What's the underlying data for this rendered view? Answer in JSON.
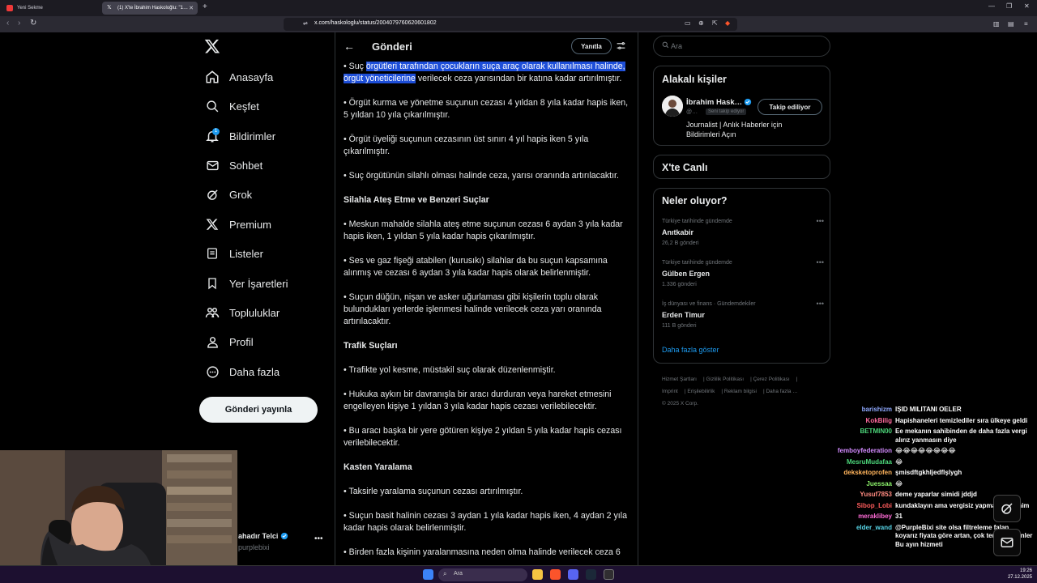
{
  "browser": {
    "tabs": [
      {
        "label": "Yeni Sekme"
      },
      {
        "label": "(1) X'te İbrahim Haskoloğlu: \"1…"
      }
    ],
    "url": "x.com/haskologlu/status/2004079760620601802"
  },
  "x": {
    "nav": [
      {
        "label": "Anasayfa"
      },
      {
        "label": "Keşfet"
      },
      {
        "label": "Bildirimler",
        "badge": "1"
      },
      {
        "label": "Sohbet"
      },
      {
        "label": "Grok"
      },
      {
        "label": "Premium"
      },
      {
        "label": "Listeler"
      },
      {
        "label": "Yer İşaretleri"
      },
      {
        "label": "Topluluklar"
      },
      {
        "label": "Profil"
      },
      {
        "label": "Daha fazla"
      }
    ],
    "post_button": "Gönderi yayınla",
    "account": {
      "name": "ahadır Telci",
      "handle": "purplebixi"
    }
  },
  "main": {
    "title": "Gönderi",
    "reply_button": "Yanıtla",
    "body": {
      "p1_a": "• Suç ",
      "p1_hl": "örgütleri tarafından çocukların suça araç olarak kullanılması halinde, örgüt yöneticilerine",
      "p1_b": " verilecek ceza yarısından bir katına kadar artırılmıştır.",
      "p2": "• Örgüt kurma ve yönetme suçunun cezası 4 yıldan 8 yıla kadar hapis iken, 5 yıldan 10 yıla çıkarılmıştır.",
      "p3": "• Örgüt üyeliği suçunun cezasının üst sınırı 4 yıl hapis iken 5 yıla çıkarılmıştır.",
      "p4": "• Suç örgütünün silahlı olması halinde ceza, yarısı oranında artırılacaktır.",
      "h1": "Silahla Ateş Etme ve Benzeri Suçlar",
      "p5": "• Meskun mahalde silahla ateş etme suçunun cezası 6 aydan 3 yıla kadar hapis iken, 1 yıldan 5 yıla kadar hapis çıkarılmıştır.",
      "p6": "• Ses ve gaz fişeği atabilen (kurusıkı) silahlar da bu suçun kapsamına alınmış ve cezası 6 aydan 3 yıla kadar hapis olarak belirlenmiştir.",
      "p7": "• Suçun düğün, nişan ve asker uğurlaması gibi kişilerin toplu olarak bulundukları yerlerde işlenmesi halinde verilecek ceza yarı oranında artırılacaktır.",
      "h2": "Trafik Suçları",
      "p8": "• Trafikte yol kesme, müstakil suç olarak düzenlenmiştir.",
      "p9": "• Hukuka aykırı bir davranışla bir aracı durduran veya hareket etmesini engelleyen kişiye 1 yıldan 3 yıla kadar hapis cezası verilebilecektir.",
      "p10": "• Bu aracı başka bir yere götüren kişiye 2 yıldan 5 yıla kadar hapis cezası verilebilecektir.",
      "h3": "Kasten Yaralama",
      "p11": "• Taksirle yaralama suçunun cezası artırılmıştır.",
      "p12": "• Suçun basit halinin cezası 3 aydan 1 yıla kadar hapis iken, 4 aydan 2 yıla kadar hapis olarak belirlenmiştir.",
      "p13": "• Birden fazla kişinin yaralanmasına neden olma halinde verilecek ceza 6"
    }
  },
  "right": {
    "search_placeholder": "Ara",
    "related_title": "Alakalı kişiler",
    "person": {
      "name": "İbrahim Hask…",
      "handle": "@…",
      "follows_you": "Seni takip ediyor",
      "follow_label": "Takip ediliyor",
      "bio": "Journalist | Anlık Haberler için Bildirimleri Açın"
    },
    "live_title": "X'te Canlı",
    "trends_title": "Neler oluyor?",
    "trends": [
      {
        "context": "Türkiye tarihinde gündemde",
        "name": "Anıtkabir",
        "count": "26,2 B gönderi"
      },
      {
        "context": "Türkiye tarihinde gündemde",
        "name": "Gülben Ergen",
        "count": "1.336 gönderi"
      },
      {
        "context": "İş dünyası ve finans · Gündemdekiler",
        "name": "Erden Timur",
        "count": "111 B gönderi"
      }
    ],
    "show_more": "Daha fazla göster",
    "footer": [
      "Hizmet Şartları",
      "Gizlilik Politikası",
      "Çerez Politikası",
      "Imprint",
      "Erişilebilirlik",
      "Reklam bilgisi",
      "Daha fazla …",
      "© 2025 X Corp."
    ]
  },
  "chat": [
    {
      "user": "barishizm",
      "color": "#8fa9ff",
      "msg": "IŞID MILITANI OELER"
    },
    {
      "user": "KokBilig",
      "color": "#ff6b9e",
      "msg": "Hapishaneleri temizlediler sıra ülkeye geldi"
    },
    {
      "user": "BETMIN00",
      "color": "#4cd67a",
      "msg": "Ee mekanın sahibinden de daha fazla vergi alırız yanmasın diye"
    },
    {
      "user": "femboyfederation",
      "color": "#d38bff",
      "msg": "😂😂😂😂😂😂😂😂"
    },
    {
      "user": "MesruMudafaa",
      "color": "#4cd67a",
      "msg": "😂"
    },
    {
      "user": "deksketoprofen",
      "color": "#ffb45c",
      "msg": "şmisdftgkhljedflşlygh"
    },
    {
      "user": "Juessaa",
      "color": "#8cf26b",
      "msg": "😂"
    },
    {
      "user": "Yusuf7853",
      "color": "#ff8a80",
      "msg": "deme yaparlar simidi jddjd"
    },
    {
      "user": "Sibop_Lobi",
      "color": "#ff5c5c",
      "msg": "kundaklayın ama vergisiz yapmayın yeenim"
    },
    {
      "user": "meraklibey",
      "color": "#ff6bd6",
      "msg": "31"
    },
    {
      "user": "elder_wand",
      "color": "#58d6e8",
      "msg": "@PurpleBixi site olsa filtreleme falan koyarız fiyata göre artan, çok tercih edilenler Bu ayın hizmeti"
    }
  ],
  "taskbar": {
    "search_label": "Ara",
    "time": "19:26",
    "date": "27.12.2025"
  }
}
